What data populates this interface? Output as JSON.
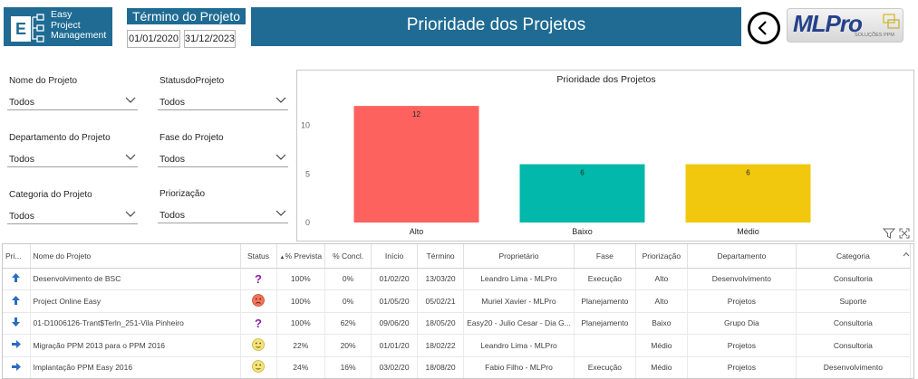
{
  "header": {
    "logo_letter": "E",
    "logo_lines": [
      "Easy",
      "Project",
      "Management"
    ],
    "termino_title": "Término do Projeto",
    "date_start": "01/01/2020",
    "date_end": "31/12/2023",
    "banner_title": "Prioridade dos Projetos",
    "brand": "MLPro",
    "brand_sub": "SOLUÇÕES PPM"
  },
  "slicers": [
    {
      "label": "Nome do Projeto",
      "value": "Todos"
    },
    {
      "label": "StatusdoProjeto",
      "value": "Todos"
    },
    {
      "label": "Departamento do Projeto",
      "value": "Todos"
    },
    {
      "label": "Fase do Projeto",
      "value": "Todos"
    },
    {
      "label": "Categoria do Projeto",
      "value": "Todos"
    },
    {
      "label": "Priorização",
      "value": "Todos"
    }
  ],
  "chart_data": {
    "type": "bar",
    "title": "Prioridade dos Projetos",
    "categories": [
      "Alto",
      "Baixo",
      "Médio"
    ],
    "values": [
      12,
      6,
      6
    ],
    "colors": [
      "#fd625e",
      "#01b8aa",
      "#f2c80f"
    ],
    "yticks": [
      0,
      5,
      10
    ],
    "ylim": [
      0,
      13.5
    ],
    "xlabel": "",
    "ylabel": "",
    "grid": false
  },
  "table": {
    "headers": [
      "Pri...",
      "Nome do Projeto",
      "Status",
      "% Prevista",
      "% Concl.",
      "Início",
      "Término",
      "Proprietário",
      "Fase",
      "Priorização",
      "Departamento",
      "Categoria"
    ],
    "rows": [
      {
        "prio_icon": "arrow-up-icon",
        "nome": "Desenvolvimento de BSC",
        "status_icon": "question-icon",
        "prevista": "100%",
        "concl": "0%",
        "inicio": "01/02/20",
        "termino": "13/03/20",
        "proprietario": "Leandro Lima - MLPro",
        "fase": "Execução",
        "priorizacao": "Alto",
        "departamento": "Desenvolvimento",
        "categoria": "Consultoria"
      },
      {
        "prio_icon": "arrow-up-icon",
        "nome": "Project Online Easy",
        "status_icon": "sad-face-icon",
        "prevista": "100%",
        "concl": "0%",
        "inicio": "01/05/20",
        "termino": "05/02/21",
        "proprietario": "Muriel Xavier - MLPro",
        "fase": "Planejamento",
        "priorizacao": "Alto",
        "departamento": "Projetos",
        "categoria": "Suporte"
      },
      {
        "prio_icon": "arrow-down-icon",
        "nome": "01-D1006126-Trant$Terln_251-Vila Pinheiro",
        "status_icon": "question-icon",
        "prevista": "100%",
        "concl": "62%",
        "inicio": "09/06/20",
        "termino": "18/05/20",
        "proprietario": "Easy20 - Julio Cesar - Dia G...",
        "fase": "Planejamento",
        "priorizacao": "Baixo",
        "departamento": "Grupo Dia",
        "categoria": "Consultoria"
      },
      {
        "prio_icon": "arrow-right-icon",
        "nome": "Migração PPM 2013 para o PPM 2016",
        "status_icon": "neutral-face-icon",
        "prevista": "22%",
        "concl": "20%",
        "inicio": "01/01/20",
        "termino": "18/02/22",
        "proprietario": "Leandro Lima - MLPro",
        "fase": "",
        "priorizacao": "Médio",
        "departamento": "Projetos",
        "categoria": "Consultoria"
      },
      {
        "prio_icon": "arrow-right-icon",
        "nome": "Implantação PPM Easy 2016",
        "status_icon": "neutral-face-icon",
        "prevista": "24%",
        "concl": "16%",
        "inicio": "03/02/20",
        "termino": "18/08/20",
        "proprietario": "Fabio Filho - MLPro",
        "fase": "Execução",
        "priorizacao": "Médio",
        "departamento": "Projetos",
        "categoria": "Desenvolvimento"
      }
    ]
  }
}
